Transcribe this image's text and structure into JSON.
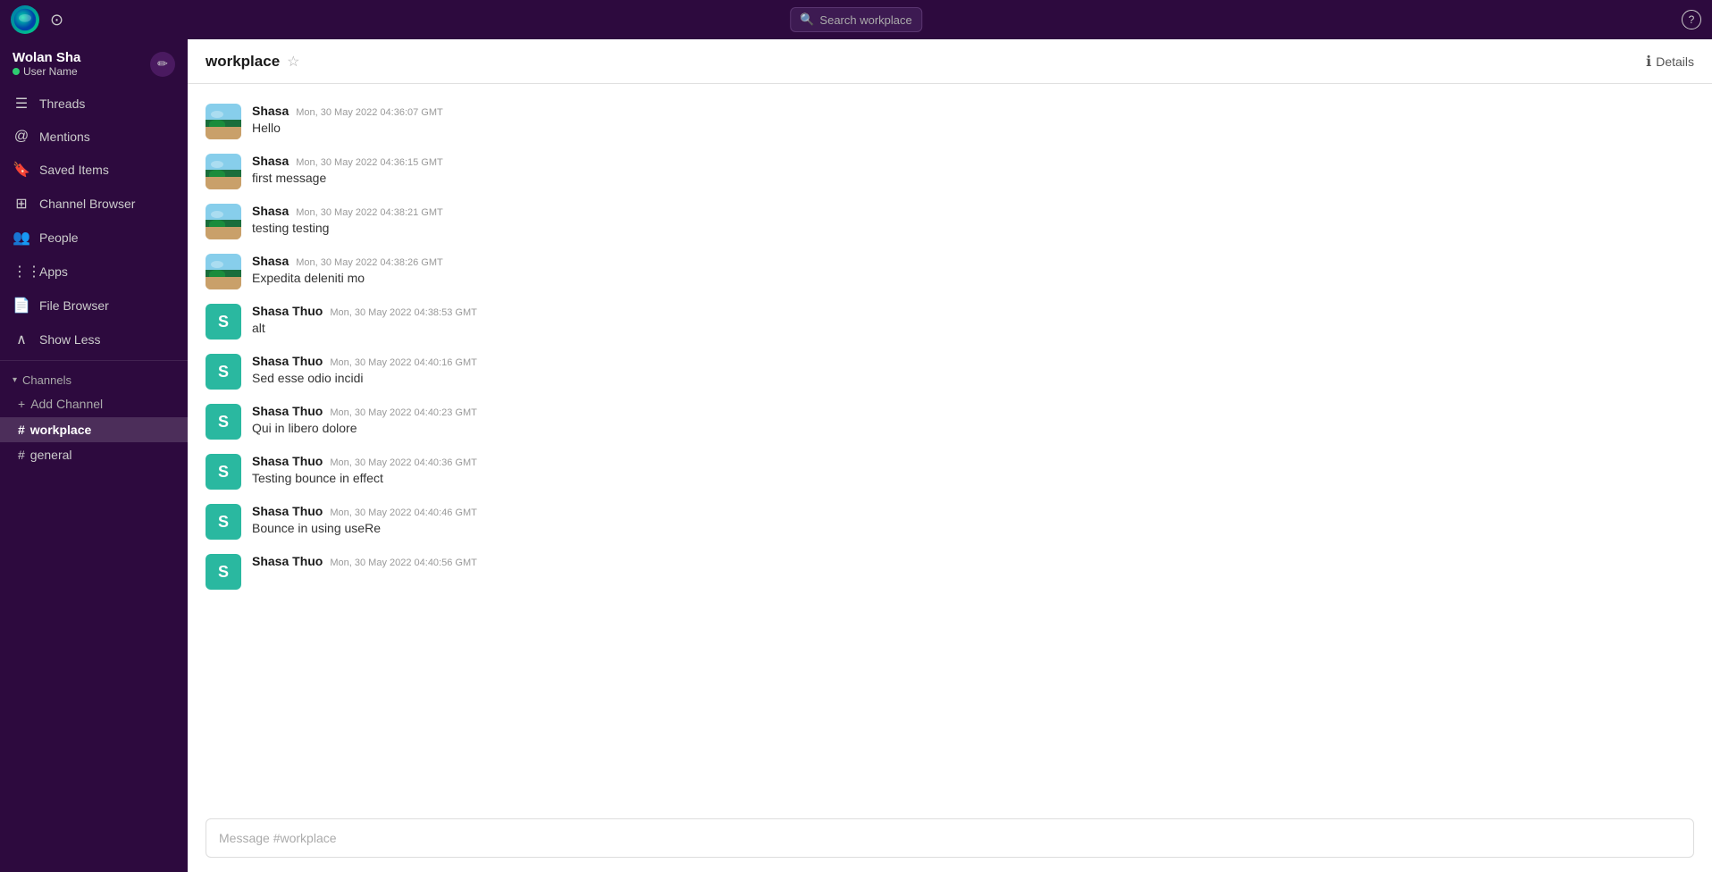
{
  "topbar": {
    "search_placeholder": "Search workplace",
    "clock_icon": "🕐",
    "help_icon": "?"
  },
  "sidebar": {
    "user": {
      "name": "Wolan Sha",
      "status_label": "User Name",
      "status_color": "#2ecc71"
    },
    "nav_items": [
      {
        "id": "threads",
        "label": "Threads",
        "icon": "☰"
      },
      {
        "id": "mentions",
        "label": "Mentions",
        "icon": "🔔"
      },
      {
        "id": "saved",
        "label": "Saved Items",
        "icon": "🔖"
      },
      {
        "id": "channels",
        "label": "Channel Browser",
        "icon": "⊞"
      },
      {
        "id": "people",
        "label": "People",
        "icon": "👥"
      },
      {
        "id": "apps",
        "label": "Apps",
        "icon": "⋮⋮"
      },
      {
        "id": "files",
        "label": "File Browser",
        "icon": "📄"
      },
      {
        "id": "showless",
        "label": "Show Less",
        "icon": "∧"
      }
    ],
    "channels_section": {
      "label": "Channels",
      "add_label": "Add Channel",
      "items": [
        {
          "id": "workplace",
          "name": "workplace",
          "active": true
        },
        {
          "id": "general",
          "name": "general",
          "active": false
        }
      ]
    }
  },
  "channel": {
    "name": "workplace",
    "details_label": "Details"
  },
  "messages": [
    {
      "id": "msg1",
      "sender": "Shasa",
      "time": "Mon, 30 May 2022 04:36:07 GMT",
      "text": "Hello",
      "avatar_type": "beach"
    },
    {
      "id": "msg2",
      "sender": "Shasa",
      "time": "Mon, 30 May 2022 04:36:15 GMT",
      "text": "first message",
      "avatar_type": "beach"
    },
    {
      "id": "msg3",
      "sender": "Shasa",
      "time": "Mon, 30 May 2022 04:38:21 GMT",
      "text": "testing testing",
      "avatar_type": "beach"
    },
    {
      "id": "msg4",
      "sender": "Shasa",
      "time": "Mon, 30 May 2022 04:38:26 GMT",
      "text": "Expedita deleniti mo",
      "avatar_type": "beach"
    },
    {
      "id": "msg5",
      "sender": "Shasa Thuo",
      "time": "Mon, 30 May 2022 04:38:53 GMT",
      "text": "alt",
      "avatar_type": "letter",
      "letter": "S"
    },
    {
      "id": "msg6",
      "sender": "Shasa Thuo",
      "time": "Mon, 30 May 2022 04:40:16 GMT",
      "text": "Sed esse odio incidi",
      "avatar_type": "letter",
      "letter": "S"
    },
    {
      "id": "msg7",
      "sender": "Shasa Thuo",
      "time": "Mon, 30 May 2022 04:40:23 GMT",
      "text": "Qui in libero dolore",
      "avatar_type": "letter",
      "letter": "S"
    },
    {
      "id": "msg8",
      "sender": "Shasa Thuo",
      "time": "Mon, 30 May 2022 04:40:36 GMT",
      "text": "Testing bounce in effect",
      "avatar_type": "letter",
      "letter": "S"
    },
    {
      "id": "msg9",
      "sender": "Shasa Thuo",
      "time": "Mon, 30 May 2022 04:40:46 GMT",
      "text": "Bounce in using useRe",
      "avatar_type": "letter",
      "letter": "S"
    },
    {
      "id": "msg10",
      "sender": "Shasa Thuo",
      "time": "Mon, 30 May 2022 04:40:56 GMT",
      "text": "",
      "avatar_type": "letter",
      "letter": "S"
    }
  ],
  "message_input": {
    "placeholder": "Message #workplace"
  }
}
